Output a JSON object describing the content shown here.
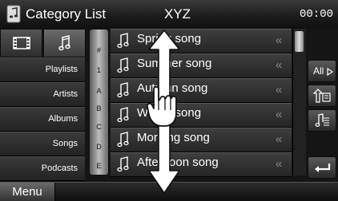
{
  "header": {
    "title": "Category List",
    "source": "XYZ",
    "clock": "00:00"
  },
  "category_tabs": [
    {
      "name": "video",
      "icon": "film-icon",
      "active": false
    },
    {
      "name": "music",
      "icon": "music-note-icon",
      "active": true
    }
  ],
  "categories": [
    "Playlists",
    "Artists",
    "Albums",
    "Songs",
    "Podcasts"
  ],
  "alpha_index": [
    "#",
    "1",
    "A",
    "B",
    "C",
    "D",
    "E"
  ],
  "songs": [
    {
      "label": "Spring song"
    },
    {
      "label": "Summer song"
    },
    {
      "label": "Autumn song"
    },
    {
      "label": "Winter song"
    },
    {
      "label": "Morning song"
    },
    {
      "label": "Afternoon song"
    }
  ],
  "song_action_glyph": "«",
  "side_buttons": {
    "all_label": "All",
    "all_icon": "play-right-icon",
    "up_icon": "folder-up-icon",
    "playlist_icon": "playlist-icon",
    "back_icon": "return-arrow-icon"
  },
  "footer": {
    "menu_label": "Menu"
  },
  "overlay": {
    "icons": [
      "vertical-drag-arrow-icon",
      "pointing-hand-icon"
    ]
  }
}
